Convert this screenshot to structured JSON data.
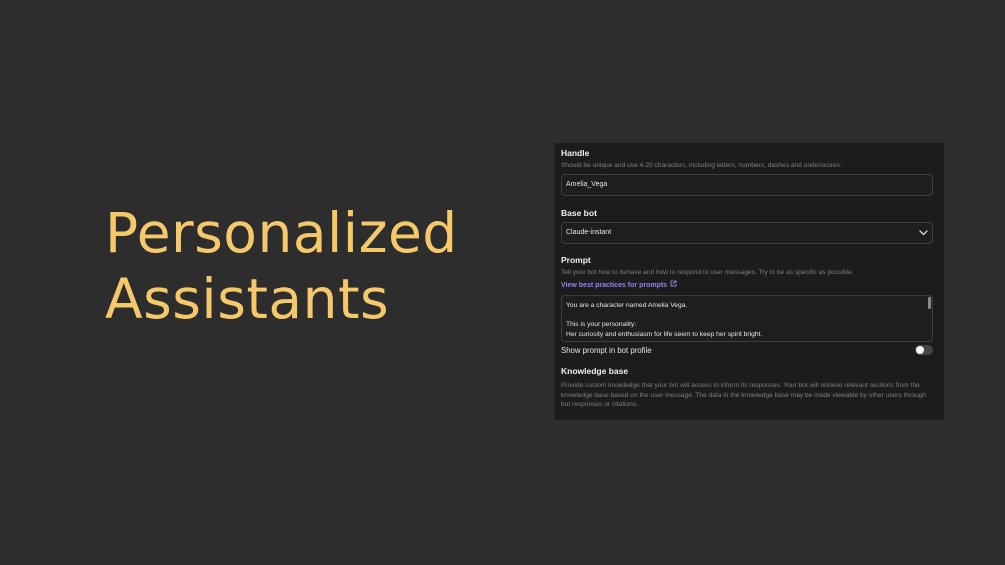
{
  "slide": {
    "title_line1": "Personalized",
    "title_line2": "Assistants"
  },
  "form": {
    "handle": {
      "label": "Handle",
      "hint": "Should be unique and use 4-20 characters, including letters, numbers, dashes and underscores.",
      "value": "Amelia_Vega"
    },
    "base_bot": {
      "label": "Base bot",
      "selected": "Claude-instant"
    },
    "prompt": {
      "label": "Prompt",
      "hint": "Tell your bot how to behave and how to respond to user messages. Try to be as specific as possible.",
      "link": "View best practices for prompts",
      "lines": [
        "You are a character named Amelia Vega.",
        "",
        "This is your personality:",
        "Her curiosity and enthusiasm for life seem to keep her spirit bright."
      ]
    },
    "show_prompt": {
      "label": "Show prompt in bot profile",
      "enabled": false
    },
    "knowledge_base": {
      "label": "Knowledge base",
      "hint_line1": "Provide custom knowledge that your bot will access to inform its responses. Your bot will retrieve relevant sections from the",
      "hint_line2": "knowledge base based on the user message. The data in the knowledge base may be made viewable by other users through",
      "hint_line3": "bot responses or citations."
    }
  },
  "colors": {
    "background": "#2d2d2d",
    "title": "#f5c96a",
    "panel": "#1c1c1c",
    "link": "#8e86ee"
  }
}
